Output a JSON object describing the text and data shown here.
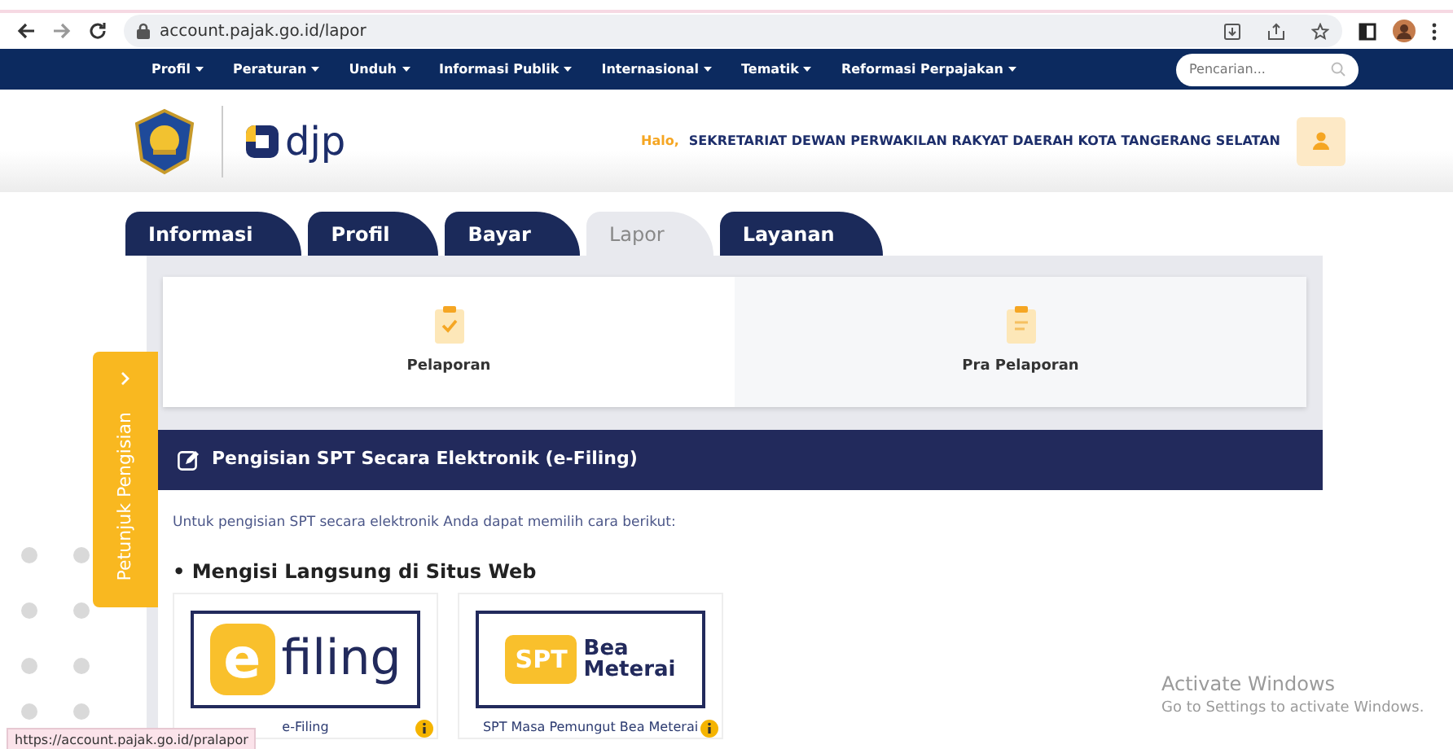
{
  "browser": {
    "url": "account.pajak.go.id/lapor",
    "status_url": "https://account.pajak.go.id/pralapor"
  },
  "nav": {
    "items": [
      "Profil",
      "Peraturan",
      "Unduh",
      "Informasi Publik",
      "Internasional",
      "Tematik",
      "Reformasi Perpajakan"
    ],
    "search": {
      "placeholder": "Pencarian..."
    }
  },
  "header": {
    "logo_text": "djp",
    "greeting": "Halo,",
    "user": "SEKRETARIAT DEWAN PERWAKILAN RAKYAT DAERAH KOTA TANGERANG SELATAN"
  },
  "tabs": [
    {
      "label": "Informasi",
      "selected": false
    },
    {
      "label": "Profil",
      "selected": false
    },
    {
      "label": "Bayar",
      "selected": false
    },
    {
      "label": "Lapor",
      "selected": true
    },
    {
      "label": "Layanan",
      "selected": false
    }
  ],
  "report_options": [
    {
      "label": "Pelaporan",
      "selected": true
    },
    {
      "label": "Pra Pelaporan",
      "selected": false
    }
  ],
  "side_tab": {
    "label": "Petunjuk Pengisian"
  },
  "section": {
    "title": "Pengisian SPT Secara Elektronik (e-Filing)",
    "intro": "Untuk pengisian SPT secara elektronik Anda dapat memilih cara berikut:",
    "subheading": "• Mengisi Langsung di Situs Web"
  },
  "apps": [
    {
      "kind": "efiling",
      "logo": [
        "e",
        "filing"
      ],
      "label": "e-Filing"
    },
    {
      "kind": "meterai",
      "logo": [
        "SPT",
        "Bea",
        "Meterai"
      ],
      "label": "SPT Masa Pemungut Bea Meterai"
    }
  ],
  "os_notice": {
    "title": "Activate Windows",
    "subtitle": "Go to Settings to activate Windows."
  }
}
